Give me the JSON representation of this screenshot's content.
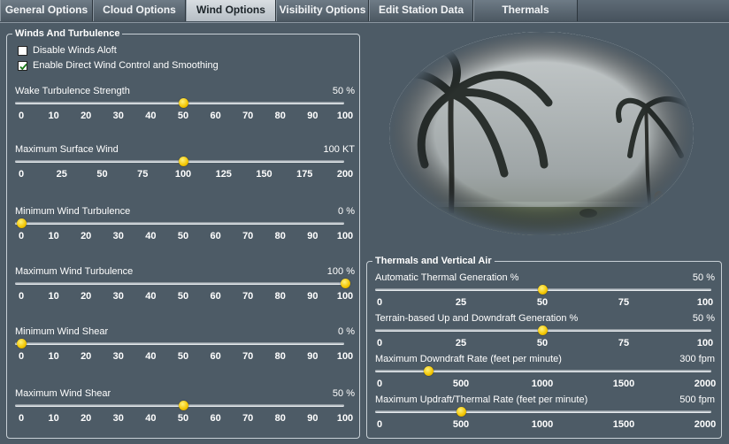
{
  "tabs": [
    {
      "label": "General Options",
      "active": false
    },
    {
      "label": "Cloud Options",
      "active": false
    },
    {
      "label": "Wind Options",
      "active": true
    },
    {
      "label": "Visibility Options",
      "active": false
    },
    {
      "label": "Edit Station Data",
      "active": false
    },
    {
      "label": "Thermals",
      "active": false
    }
  ],
  "winds_group": {
    "title": "Winds And Turbulence",
    "disable_winds_aloft": {
      "label": "Disable Winds Aloft",
      "checked": false
    },
    "direct_wind_control": {
      "label": "Enable Direct Wind Control and Smoothing",
      "checked": true
    },
    "sliders": [
      {
        "label": "Wake Turbulence Strength",
        "value_text": "50 %",
        "min": 0,
        "max": 100,
        "value": 50,
        "ticks": [
          "0",
          "10",
          "20",
          "30",
          "40",
          "50",
          "60",
          "70",
          "80",
          "90",
          "100"
        ]
      },
      {
        "label": "Maximum Surface Wind",
        "value_text": "100 KT",
        "min": 0,
        "max": 200,
        "value": 100,
        "ticks": [
          "0",
          "25",
          "50",
          "75",
          "100",
          "125",
          "150",
          "175",
          "200"
        ]
      },
      {
        "label": "Minimum Wind Turbulence",
        "value_text": "0 %",
        "min": 0,
        "max": 100,
        "value": 0,
        "ticks": [
          "0",
          "10",
          "20",
          "30",
          "40",
          "50",
          "60",
          "70",
          "80",
          "90",
          "100"
        ]
      },
      {
        "label": "Maximum Wind Turbulence",
        "value_text": "100 %",
        "min": 0,
        "max": 100,
        "value": 100,
        "ticks": [
          "0",
          "10",
          "20",
          "30",
          "40",
          "50",
          "60",
          "70",
          "80",
          "90",
          "100"
        ]
      },
      {
        "label": "Minimum Wind Shear",
        "value_text": "0 %",
        "min": 0,
        "max": 100,
        "value": 0,
        "ticks": [
          "0",
          "10",
          "20",
          "30",
          "40",
          "50",
          "60",
          "70",
          "80",
          "90",
          "100"
        ]
      },
      {
        "label": "Maximum Wind Shear",
        "value_text": "50 %",
        "min": 0,
        "max": 100,
        "value": 50,
        "ticks": [
          "0",
          "10",
          "20",
          "30",
          "40",
          "50",
          "60",
          "70",
          "80",
          "90",
          "100"
        ]
      }
    ]
  },
  "thermals_group": {
    "title": "Thermals and Vertical Air",
    "sliders": [
      {
        "label": "Automatic Thermal Generation %",
        "value_text": "50 %",
        "min": 0,
        "max": 100,
        "value": 50,
        "ticks": [
          "0",
          "25",
          "50",
          "75",
          "100"
        ]
      },
      {
        "label": "Terrain-based Up and Downdraft Generation %",
        "value_text": "50 %",
        "min": 0,
        "max": 100,
        "value": 50,
        "ticks": [
          "0",
          "25",
          "50",
          "75",
          "100"
        ]
      },
      {
        "label": "Maximum Downdraft Rate (feet per minute)",
        "value_text": "300 fpm",
        "min": 0,
        "max": 2000,
        "value": 300,
        "ticks": [
          "0",
          "500",
          "1000",
          "1500",
          "2000"
        ]
      },
      {
        "label": "Maximum Updraft/Thermal Rate (feet per minute)",
        "value_text": "500 fpm",
        "min": 0,
        "max": 2000,
        "value": 500,
        "ticks": [
          "0",
          "500",
          "1000",
          "1500",
          "2000"
        ]
      }
    ]
  },
  "photo": {
    "icon": "storm-palm-trees-image"
  }
}
